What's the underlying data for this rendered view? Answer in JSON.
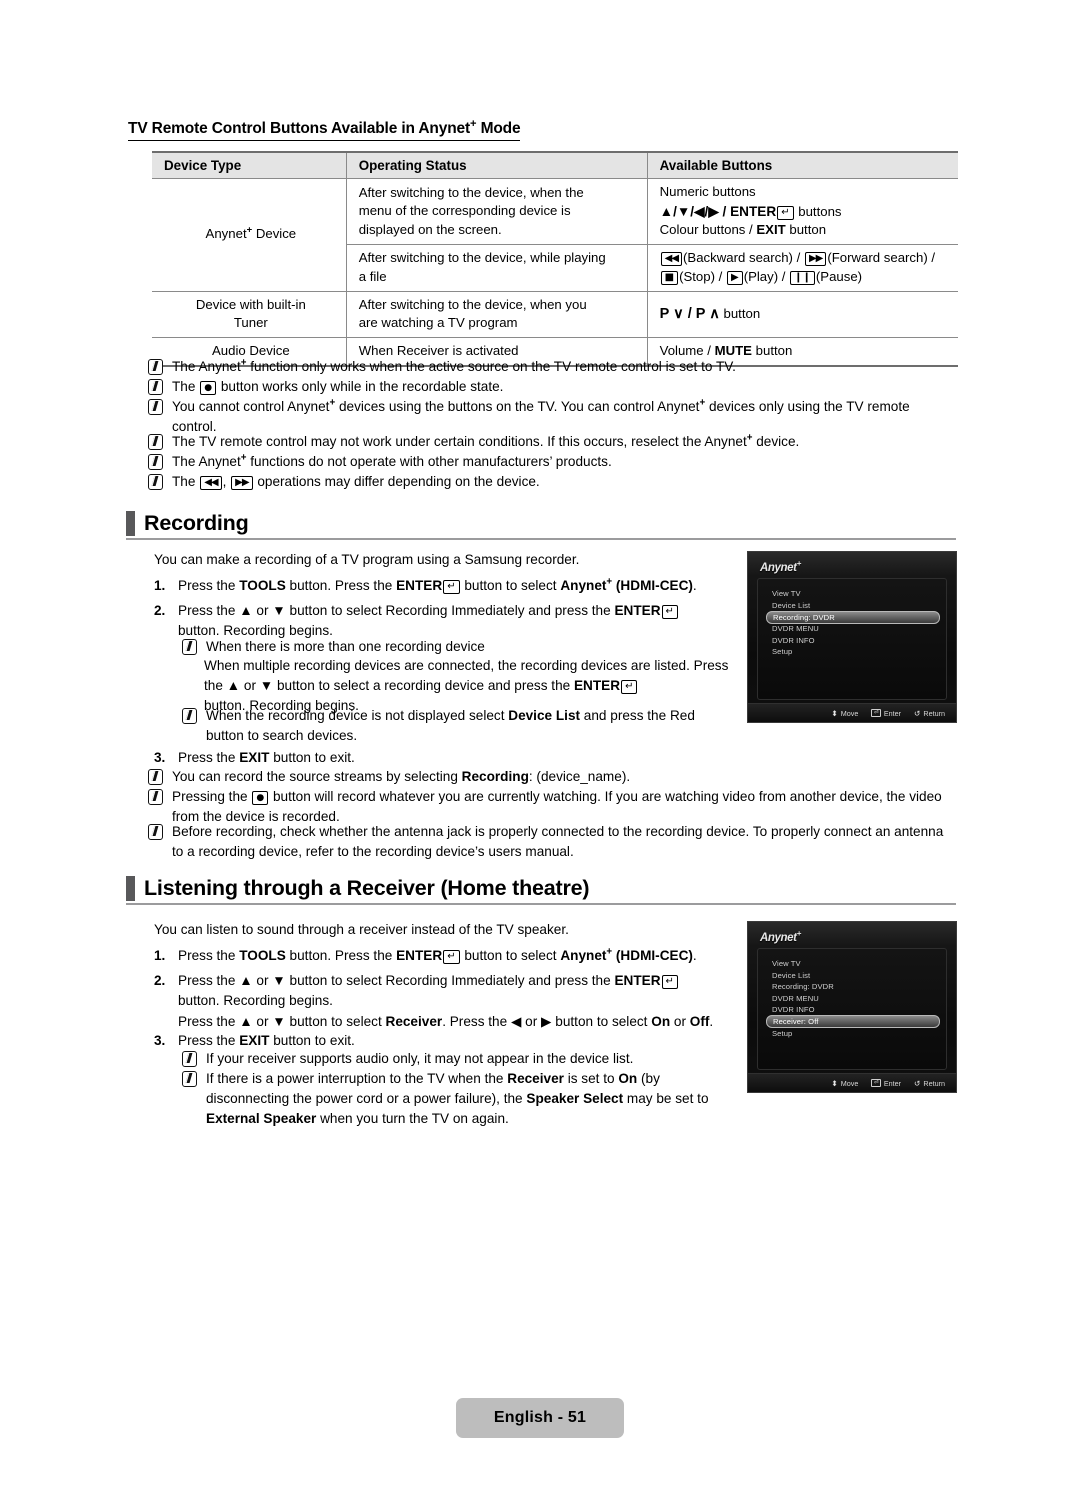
{
  "section_table": {
    "heading": "TV Remote Control Buttons Available in Anynet",
    "heading_sup": "+",
    "heading_tail": " Mode",
    "columns": [
      "Device Type",
      "Operating Status",
      "Available Buttons"
    ],
    "rows": [
      {
        "device_type": "Anynet+ Device",
        "status": "After switching to the device, when the menu of the corresponding device is displayed on the screen.",
        "buttons_lines": [
          "Numeric buttons",
          "▲/▼/◀/▶ / ENTER ⏎ buttons",
          "Colour buttons / EXIT button"
        ]
      },
      {
        "device_type": "",
        "status": "After switching to the device, while playing a file",
        "buttons_lines": [
          "◀◀(Backward search) / ▶▶(Forward search) /",
          "■(Stop) / ▶(Play) / ▮▮(Pause)"
        ]
      },
      {
        "device_type": "Device with built-in Tuner",
        "status": "After switching to the device, when you are watching a TV program",
        "buttons_lines": [
          "P ∨ / P ∧ button"
        ]
      },
      {
        "device_type": "Audio Device",
        "status": "When Receiver is activated",
        "buttons_lines": [
          "Volume / MUTE button"
        ]
      }
    ],
    "notes": [
      "The Anynet+ function only works when the active source on the TV remote control is set to TV.",
      "The ● button works only while in the recordable state.",
      "You cannot control Anynet+ devices using the buttons on the TV. You can control Anynet+ devices only using the TV remote control.",
      "The TV remote control may not work under certain conditions. If this occurs, reselect the Anynet+ device.",
      "The Anynet+ functions do not operate with other manufacturers’ products.",
      "The ◀◀, ▶▶ operations may differ depending on the device."
    ]
  },
  "recording": {
    "heading": "Recording",
    "intro": "You can make a recording of a TV program using a Samsung recorder.",
    "step1_num": "1.",
    "step1_a": "Press the ",
    "step1_tools": "TOOLS",
    "step1_b": " button. Press the ",
    "step1_enter": "ENTER",
    "step1_c": " button to select ",
    "step1_anynet": "Anynet",
    "step1_sup": "+",
    "step1_hdmi": " (HDMI-CEC)",
    "step1_end": ".",
    "step2_num": "2.",
    "step2_a": "Press the ▲ or ▼ button to select Recording Immediately and press the ",
    "step2_enter": "ENTER",
    "step2_b": "button. Recording begins.",
    "note1_title": "When there is more than one recording device",
    "note1_body_a": "When multiple recording devices are connected, the recording devices are listed. Press the ▲ or ▼ button to select a recording device and press the ",
    "note1_enter": "ENTER",
    "note1_body_b": "button. Recording begins.",
    "note2_a": "When the recording device is not displayed select ",
    "note2_bold": "Device List",
    "note2_b": " and press the Red button to search devices.",
    "step3_num": "3.",
    "step3_a": "Press the ",
    "step3_exit": "EXIT",
    "step3_b": " button to exit.",
    "bullets": [
      {
        "a": "You can record the source streams by selecting ",
        "bold": "Recording",
        "b": ": (device_name)."
      },
      {
        "a": "Pressing the ● button will record whatever you are currently watching. If you are watching video from another device, the video from the device is recorded."
      },
      {
        "a": "Before recording, check whether the antenna jack is properly connected to the recording device. To properly connect an antenna to a recording device, refer to the recording device’s users manual."
      }
    ],
    "osd": {
      "logo": "Anynet",
      "logo_sup": "+",
      "items": [
        {
          "label": "View TV",
          "selected": false
        },
        {
          "label": "Device List",
          "selected": false
        },
        {
          "label": "Recording: DVDR",
          "selected": true
        },
        {
          "label": "DVDR MENU",
          "selected": false
        },
        {
          "label": "DVDR INFO",
          "selected": false
        },
        {
          "label": "Setup",
          "selected": false
        }
      ],
      "footer": [
        {
          "glyph": "⬍",
          "label": "Move"
        },
        {
          "glyph": "⏎",
          "label": "Enter"
        },
        {
          "glyph": "↺",
          "label": "Return"
        }
      ]
    }
  },
  "listening": {
    "heading": "Listening through a Receiver (Home theatre)",
    "intro": "You can listen to sound through a receiver instead of the TV speaker.",
    "step1_num": "1.",
    "step1_a": "Press the ",
    "step1_tools": "TOOLS",
    "step1_b": " button. Press the ",
    "step1_enter": "ENTER",
    "step1_c": " button to select ",
    "step1_anynet": "Anynet",
    "step1_sup": "+",
    "step1_hdmi": " (HDMI-CEC)",
    "step1_end": ".",
    "step2_num": "2.",
    "step2_a": "Press the ▲ or ▼ button to select Recording Immediately and press the ",
    "step2_enter": "ENTER",
    "step2_b": "button. Recording begins.",
    "step2_c_a": "Press the ▲ or ▼ button to select ",
    "step2_c_receiver": "Receiver",
    "step2_c_b": ". Press the ◀ or ▶ button to select ",
    "step2_c_on": "On",
    "step2_c_c": " or ",
    "step2_c_off": "Off",
    "step2_c_end": ".",
    "step3_num": "3.",
    "step3_a": "Press the ",
    "step3_exit": "EXIT",
    "step3_b": " button to exit.",
    "note1": "If your receiver supports audio only, it may not appear in the device list.",
    "note2_a": "If there is a power interruption to the TV when the ",
    "note2_receiver": "Receiver",
    "note2_b": " is set to ",
    "note2_on": "On",
    "note2_c": " (by disconnecting the power cord or a power failure), the ",
    "note2_speaker": "Speaker Select",
    "note2_d": " may be set to ",
    "note2_ext": "External Speaker",
    "note2_e": " when you turn the TV on again.",
    "osd": {
      "logo": "Anynet",
      "logo_sup": "+",
      "items": [
        {
          "label": "View TV",
          "selected": false
        },
        {
          "label": "Device List",
          "selected": false
        },
        {
          "label": "Recording: DVDR",
          "selected": false
        },
        {
          "label": "DVDR MENU",
          "selected": false
        },
        {
          "label": "DVDR INFO",
          "selected": false
        },
        {
          "label": "Receiver: Off",
          "selected": true
        },
        {
          "label": "Setup",
          "selected": false
        }
      ],
      "footer": [
        {
          "glyph": "⬍",
          "label": "Move"
        },
        {
          "glyph": "⏎",
          "label": "Enter"
        },
        {
          "glyph": "↺",
          "label": "Return"
        }
      ]
    }
  },
  "page_footer": {
    "label": "English - 51"
  }
}
